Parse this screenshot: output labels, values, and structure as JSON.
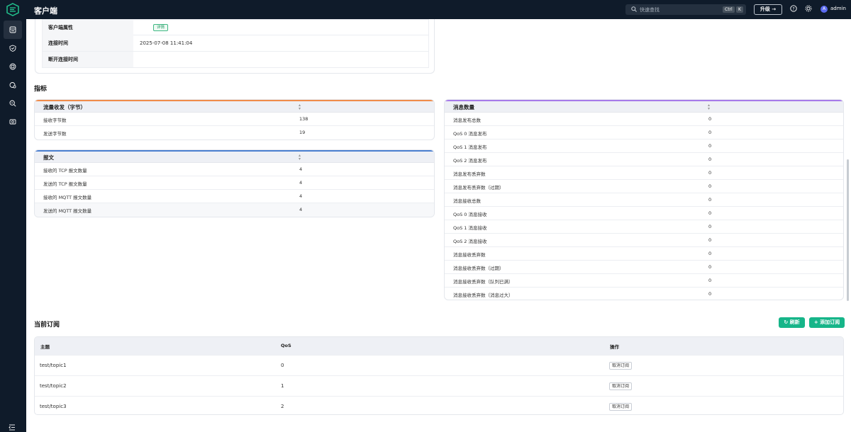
{
  "header": {
    "title": "客户端",
    "search_placeholder": "快速查找",
    "kbd_ctrl": "Ctrl",
    "kbd_k": "K",
    "upgrade_label": "升级 →",
    "avatar_letter": "A",
    "user_name": "admin"
  },
  "sidebar": {
    "items": [
      {
        "icon": "client-icon",
        "active": true
      },
      {
        "icon": "shield-icon"
      },
      {
        "icon": "rule-icon"
      },
      {
        "icon": "integration-icon"
      },
      {
        "icon": "diagnose-icon"
      },
      {
        "icon": "management-icon"
      }
    ]
  },
  "client_info": {
    "rows": [
      {
        "label": "客户端属性",
        "value": "",
        "tag": "详情"
      },
      {
        "label": "连接时间",
        "value": "2025-07-08 11:41:04"
      },
      {
        "label": "断开连接时间",
        "value": ""
      }
    ]
  },
  "metrics": {
    "title": "指标",
    "traffic": {
      "title": "流量收发（字节）",
      "accent": "#f08c4a",
      "rows": [
        {
          "label": "接收字节数",
          "value": "138"
        },
        {
          "label": "发送字节数",
          "value": "19"
        }
      ]
    },
    "packets": {
      "title": "报文",
      "accent": "#4a7fd0",
      "rows": [
        {
          "label": "接收的 TCP 报文数量",
          "value": "4"
        },
        {
          "label": "发送的 TCP 报文数量",
          "value": "4"
        },
        {
          "label": "接收的 MQTT 报文数量",
          "value": "4"
        },
        {
          "label": "发送的 MQTT 报文数量",
          "value": "4"
        }
      ]
    },
    "messages": {
      "title": "消息数量",
      "accent": "#a77bea",
      "rows": [
        {
          "label": "消息发布总数",
          "value": "0"
        },
        {
          "label": "QoS 0 消息发布",
          "value": "0"
        },
        {
          "label": "QoS 1 消息发布",
          "value": "0"
        },
        {
          "label": "QoS 2 消息发布",
          "value": "0"
        },
        {
          "label": "消息发布丢弃数",
          "value": "0"
        },
        {
          "label": "消息发布丢弃数（过期）",
          "value": "0"
        },
        {
          "label": "消息接收总数",
          "value": "0"
        },
        {
          "label": "QoS 0 消息接收",
          "value": "0"
        },
        {
          "label": "QoS 1 消息接收",
          "value": "0"
        },
        {
          "label": "QoS 2 消息接收",
          "value": "0"
        },
        {
          "label": "消息接收丢弃数",
          "value": "0"
        },
        {
          "label": "消息接收丢弃数（过期）",
          "value": "0"
        },
        {
          "label": "消息接收丢弃数（队列已满）",
          "value": "0"
        },
        {
          "label": "消息接收丢弃数（消息过大）",
          "value": "0"
        }
      ]
    }
  },
  "subscriptions": {
    "title": "当前订阅",
    "refresh_label": "刷新",
    "add_label": "添加订阅",
    "columns": [
      "主题",
      "QoS",
      "操作"
    ],
    "rows": [
      {
        "topic": "test/topic1",
        "qos": "0",
        "action": "取消订阅"
      },
      {
        "topic": "test/topic2",
        "qos": "1",
        "action": "取消订阅"
      },
      {
        "topic": "test/topic3",
        "qos": "2",
        "action": "取消订阅"
      }
    ]
  }
}
